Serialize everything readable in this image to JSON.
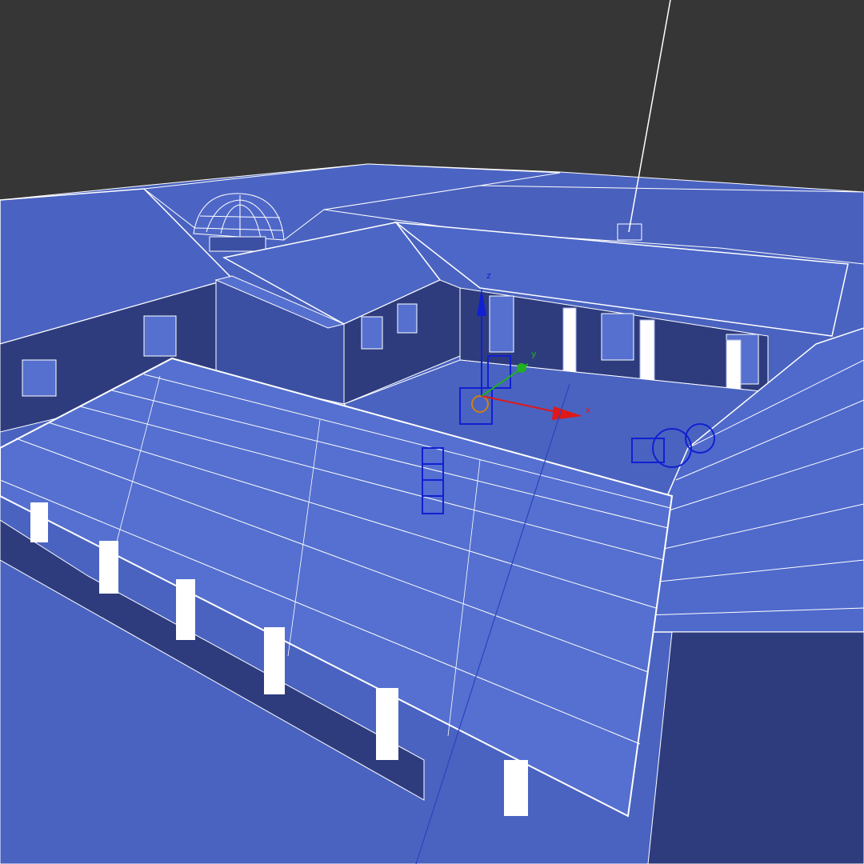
{
  "viewport": {
    "shading_mode": "wireframe-over-shaded",
    "background_color": "#363636",
    "ground_color": "#4a63c0",
    "wire_color": "#ffffff",
    "dark_face_color": "#2e3c7e",
    "mid_face_color": "#3b4fa3",
    "light_face_color": "#5670cf"
  },
  "gizmo": {
    "x_label": "x",
    "y_label": "y",
    "z_label": "z",
    "x_color": "#e01818",
    "y_color": "#20b020",
    "z_color": "#1020d0"
  },
  "scene": {
    "description_objects": [
      "courtyard-ground",
      "front-colonnade-roof",
      "right-wing-roof",
      "back-left-building",
      "back-right-building",
      "dome",
      "courtyard-columns",
      "camera-object",
      "light-object",
      "ladder-object"
    ]
  }
}
